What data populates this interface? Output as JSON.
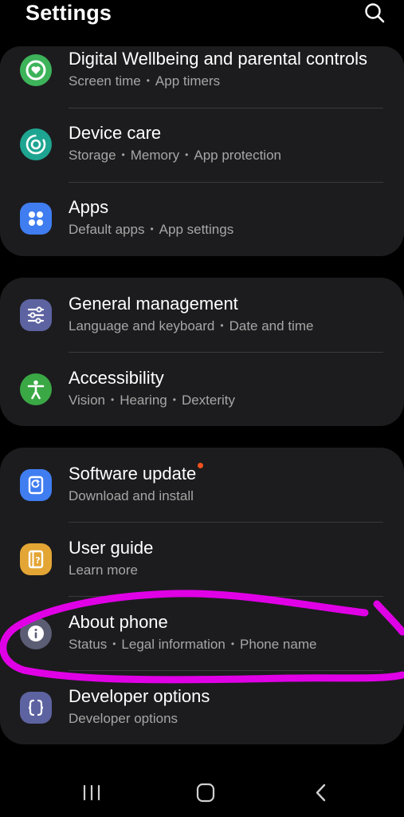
{
  "header": {
    "title": "Settings",
    "search_icon": "search-icon"
  },
  "colors": {
    "background": "#000000",
    "card": "#1c1c1e",
    "subtitle": "#a6a6a6",
    "update_dot": "#f0521f",
    "annotation": "#e000e6"
  },
  "groups": [
    {
      "items": [
        {
          "title": "Digital Wellbeing and parental controls",
          "subtitle": [
            "Screen time",
            "App timers"
          ],
          "icon": "digital-wellbeing-icon",
          "icon_color": "#3db35a"
        },
        {
          "title": "Device care",
          "subtitle": [
            "Storage",
            "Memory",
            "App protection"
          ],
          "icon": "device-care-icon",
          "icon_color": "#1ea591"
        },
        {
          "title": "Apps",
          "subtitle": [
            "Default apps",
            "App settings"
          ],
          "icon": "apps-icon",
          "icon_color": "#3f7df0"
        }
      ]
    },
    {
      "items": [
        {
          "title": "General management",
          "subtitle": [
            "Language and keyboard",
            "Date and time"
          ],
          "icon": "sliders-icon",
          "icon_color": "#5d63a0"
        },
        {
          "title": "Accessibility",
          "subtitle": [
            "Vision",
            "Hearing",
            "Dexterity"
          ],
          "icon": "accessibility-icon",
          "icon_color": "#3aa845"
        }
      ]
    },
    {
      "items": [
        {
          "title": "Software update",
          "subtitle": [
            "Download and install"
          ],
          "icon": "software-update-icon",
          "icon_color": "#3f7df0",
          "badge": true
        },
        {
          "title": "User guide",
          "subtitle": [
            "Learn more"
          ],
          "icon": "user-guide-icon",
          "icon_color": "#e3a534"
        },
        {
          "title": "About phone",
          "subtitle": [
            "Status",
            "Legal information",
            "Phone name"
          ],
          "icon": "info-icon",
          "icon_color": "#5b5d74"
        },
        {
          "title": "Developer options",
          "subtitle": [
            "Developer options"
          ],
          "icon": "developer-options-icon",
          "icon_color": "#5d63a0"
        }
      ]
    }
  ],
  "navbar": {
    "recents_icon": "recents-icon",
    "home_icon": "home-icon",
    "back_icon": "back-icon"
  }
}
